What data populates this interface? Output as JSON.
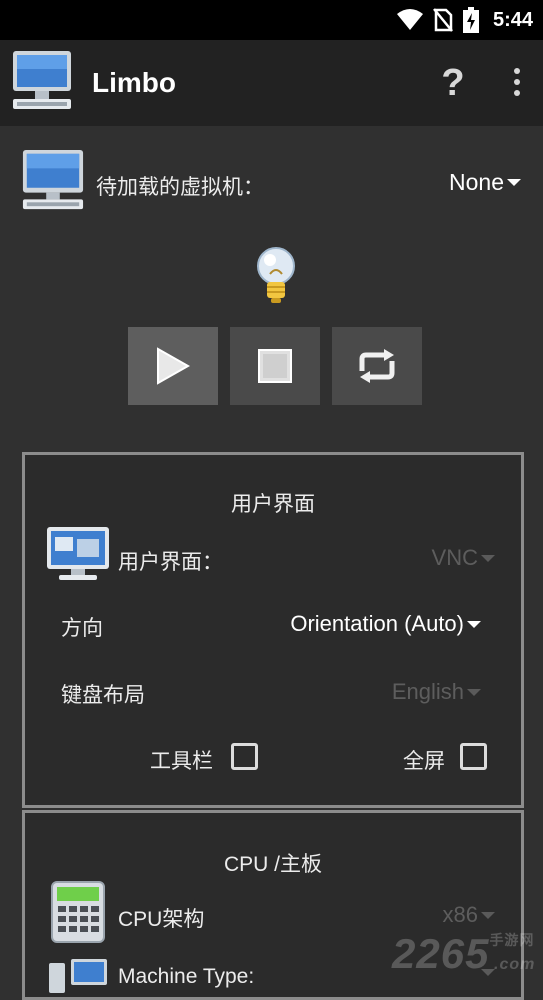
{
  "status_bar": {
    "time": "5:44",
    "icons": [
      "wifi-icon",
      "no-sim-icon",
      "battery-charging-icon"
    ]
  },
  "app_bar": {
    "title": "Limbo",
    "help_label": "?"
  },
  "vm_selector": {
    "label": "待加载的虚拟机：",
    "value": "None"
  },
  "controls": {
    "buttons": [
      "play-button",
      "stop-button",
      "restart-button"
    ]
  },
  "ui_panel": {
    "title": "用户界面",
    "ui_label": "用户界面：",
    "ui_value": "VNC",
    "orientation_label": "方向",
    "orientation_value": "Orientation (Auto)",
    "keyboard_label": "键盘布局",
    "keyboard_value": "English",
    "toolbar_label": "工具栏",
    "toolbar_checked": false,
    "fullscreen_label": "全屏",
    "fullscreen_checked": false
  },
  "cpu_panel": {
    "title": "CPU /主板",
    "arch_label": "CPU架构",
    "arch_value": "x86",
    "machine_label": "Machine Type:"
  },
  "watermark": {
    "text": "2265",
    "suffix": "手游网",
    "domain": ".com"
  },
  "colors": {
    "background": "#303030",
    "app_bar": "#222222",
    "panel_border": "#8c8c8c",
    "disabled_text": "#5d5d5d"
  }
}
